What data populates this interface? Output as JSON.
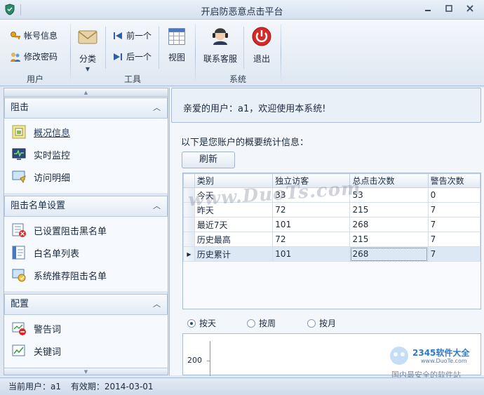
{
  "window": {
    "title": "开启防恶意点击平台",
    "min_icon": "minimize-icon",
    "max_icon": "maximize-icon",
    "close_icon": "close-icon"
  },
  "ribbon": {
    "groups": [
      {
        "label": "用户"
      },
      {
        "label": "工具"
      },
      {
        "label": "系统"
      }
    ],
    "account_info": "帐号信息",
    "change_password": "修改密码",
    "category": "分类",
    "previous": "前一个",
    "next": "后一个",
    "view": "视图",
    "contact_support": "联系客服",
    "exit": "退出"
  },
  "nav": {
    "sections": [
      {
        "title": "阻击",
        "items": [
          "概况信息",
          "实时监控",
          "访问明细"
        ]
      },
      {
        "title": "阻击名单设置",
        "items": [
          "已设置阻击黑名单",
          "白名单列表",
          "系统推荐阻击名单"
        ]
      },
      {
        "title": "配置",
        "items": [
          "警告词",
          "关键词"
        ]
      }
    ]
  },
  "main": {
    "welcome": "亲爱的用户：a1，欢迎使用本系统!",
    "summary": "以下是您账户的概要统计信息：",
    "refresh": "刷新",
    "table": {
      "headers": [
        "类别",
        "独立访客",
        "总点击次数",
        "警告次数"
      ],
      "rows": [
        [
          "今天",
          "33",
          "53",
          "0"
        ],
        [
          "昨天",
          "72",
          "215",
          "7"
        ],
        [
          "最近7天",
          "101",
          "268",
          "7"
        ],
        [
          "历史最高",
          "72",
          "215",
          "7"
        ],
        [
          "历史累计",
          "101",
          "268",
          "7"
        ]
      ]
    },
    "radios": [
      "按天",
      "按周",
      "按月"
    ],
    "selected_radio": "按天",
    "chart_tick": "200"
  },
  "watermark": {
    "text": "www.DuoTs.com",
    "brand": "2345软件大全",
    "url": "www.DuoTe.com",
    "slogan": "国内最安全的软件站"
  },
  "status": {
    "current_user": "当前用户：a1",
    "validity": "有效期：2014-03-01"
  }
}
